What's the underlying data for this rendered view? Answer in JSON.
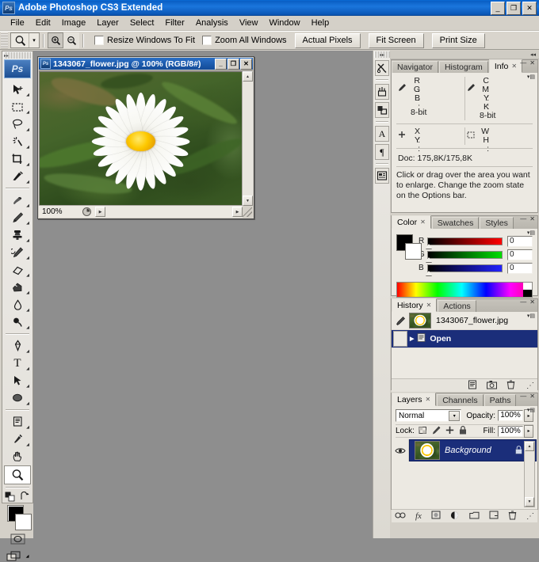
{
  "window": {
    "title": "Adobe Photoshop CS3 Extended",
    "app_icon": "Ps",
    "buttons": {
      "minimize": "_",
      "maximize": "❐",
      "close": "✕"
    }
  },
  "menubar": {
    "items": [
      "File",
      "Edit",
      "Image",
      "Layer",
      "Select",
      "Filter",
      "Analysis",
      "View",
      "Window",
      "Help"
    ]
  },
  "options_bar": {
    "active_tool_icon": "zoom-tool",
    "tool_preset_caret": "▾",
    "zoom_in_icon": "zoom-in-icon",
    "zoom_out_icon": "zoom-out-icon",
    "checkbox_resize_windows": {
      "label": "Resize Windows To Fit",
      "checked": false
    },
    "checkbox_zoom_all": {
      "label": "Zoom All Windows",
      "checked": false
    },
    "buttons": [
      "Actual Pixels",
      "Fit Screen",
      "Print Size"
    ]
  },
  "toolbox": {
    "badge": "Ps",
    "tools": [
      {
        "name": "move-tool",
        "glyph": "✥",
        "sub": true
      },
      {
        "name": "rectangular-marquee-tool",
        "glyph": "▭",
        "sub": true
      },
      {
        "name": "lasso-tool",
        "glyph": "◯",
        "sub": true
      },
      {
        "name": "magic-wand-tool",
        "glyph": "✧",
        "sub": true
      },
      {
        "name": "crop-tool",
        "glyph": "⌗",
        "sub": true
      },
      {
        "name": "slice-tool",
        "glyph": "🔪",
        "sub": true
      },
      {
        "name": "healing-brush-tool",
        "glyph": "✎",
        "sub": true
      },
      {
        "name": "brush-tool",
        "glyph": "🖌",
        "sub": true
      },
      {
        "name": "clone-stamp-tool",
        "glyph": "⎙",
        "sub": true
      },
      {
        "name": "history-brush-tool",
        "glyph": "❧",
        "sub": true
      },
      {
        "name": "eraser-tool",
        "glyph": "▱",
        "sub": true
      },
      {
        "name": "gradient-tool",
        "glyph": "◫",
        "sub": true
      },
      {
        "name": "blur-tool",
        "glyph": "💧",
        "sub": true
      },
      {
        "name": "dodge-tool",
        "glyph": "●",
        "sub": true
      },
      {
        "name": "pen-tool",
        "glyph": "✒",
        "sub": true
      },
      {
        "name": "type-tool",
        "glyph": "T",
        "sub": true
      },
      {
        "name": "path-selection-tool",
        "glyph": "➤",
        "sub": true
      },
      {
        "name": "ellipse-shape-tool",
        "glyph": "⬭",
        "sub": true
      },
      {
        "name": "notes-tool",
        "glyph": "🗒",
        "sub": true
      },
      {
        "name": "eyedropper-tool",
        "glyph": "⚲",
        "sub": true
      },
      {
        "name": "hand-tool",
        "glyph": "✋",
        "sub": false
      },
      {
        "name": "zoom-tool",
        "glyph": "⚲",
        "sub": false,
        "active": true
      }
    ],
    "swatch_default_icon": "default-colors-icon",
    "swatch_swap_icon": "swap-colors-icon",
    "foreground_color": "#000000",
    "background_color": "#ffffff",
    "quick_mask_icon": "quick-mask-icon",
    "screen_mode_icon": "screen-mode-icon"
  },
  "document": {
    "title": "1343067_flower.jpg @ 100% (RGB/8#)",
    "icon": "Ps",
    "buttons": {
      "minimize": "_",
      "maximize": "❐",
      "close": "✕"
    },
    "zoom_level": "100%",
    "status_info": "",
    "scroll_up": "▲",
    "scroll_down": "▼",
    "scroll_left": "◀",
    "scroll_right": "▶"
  },
  "dock_strip": {
    "buttons": [
      {
        "name": "tool-presets-icon",
        "glyph": "✂"
      },
      {
        "name": "brushes-icon",
        "glyph": "🖌"
      },
      {
        "name": "clone-source-icon",
        "glyph": "⧉"
      },
      {
        "name": "character-icon",
        "glyph": "A"
      },
      {
        "name": "paragraph-icon",
        "glyph": "¶"
      },
      {
        "name": "layer-comps-icon",
        "glyph": "▤"
      }
    ],
    "collapse_icon": "▸▸"
  },
  "panels": {
    "info": {
      "tabs": [
        {
          "label": "Navigator",
          "active": false,
          "closable": false
        },
        {
          "label": "Histogram",
          "active": false,
          "closable": false
        },
        {
          "label": "Info",
          "active": true,
          "closable": true
        }
      ],
      "menu_icon": "panel-menu-icon",
      "left_readout": {
        "marker": "eyedropper-icon",
        "rows": [
          "R :",
          "G :",
          "B :"
        ],
        "depth": "8-bit"
      },
      "right_readout": {
        "marker": "eyedropper-icon",
        "rows": [
          "C :",
          "M :",
          "Y :",
          "K :"
        ],
        "depth": "8-bit"
      },
      "coords": {
        "marker": "crosshair-icon",
        "rows": [
          "X :",
          "Y :"
        ]
      },
      "dimensions": {
        "marker": "selection-icon",
        "rows": [
          "W :",
          "H :"
        ]
      },
      "doc_size": "Doc: 175,8K/175,8K",
      "hint": "Click or drag over the area you want to enlarge. Change the zoom state on the Options bar."
    },
    "color": {
      "tabs": [
        {
          "label": "Color",
          "active": true,
          "closable": true
        },
        {
          "label": "Swatches",
          "active": false,
          "closable": false
        },
        {
          "label": "Styles",
          "active": false,
          "closable": false
        }
      ],
      "foreground_color": "#000000",
      "background_color": "#ffffff",
      "sliders": [
        {
          "label": "R",
          "value": "0",
          "from": "#000000",
          "to": "#ff0000"
        },
        {
          "label": "G",
          "value": "0",
          "from": "#000000",
          "to": "#00dd00"
        },
        {
          "label": "B",
          "value": "0",
          "from": "#000000",
          "to": "#2222ff"
        }
      ]
    },
    "history": {
      "tabs": [
        {
          "label": "History",
          "active": true,
          "closable": true
        },
        {
          "label": "Actions",
          "active": false,
          "closable": false
        }
      ],
      "snapshot": {
        "name": "1343067_flower.jpg",
        "icon": "history-brush-source-icon"
      },
      "states": [
        {
          "name": "Open",
          "icon": "open-state-icon",
          "selected": true
        }
      ],
      "footer_icons": [
        {
          "name": "new-document-from-state-icon",
          "glyph": "▤"
        },
        {
          "name": "new-snapshot-icon",
          "glyph": "📷"
        },
        {
          "name": "delete-state-icon",
          "glyph": "🗑"
        }
      ]
    },
    "layers": {
      "tabs": [
        {
          "label": "Layers",
          "active": true,
          "closable": true
        },
        {
          "label": "Channels",
          "active": false,
          "closable": false
        },
        {
          "label": "Paths",
          "active": false,
          "closable": false
        }
      ],
      "blend_mode": "Normal",
      "opacity_label": "Opacity:",
      "opacity_value": "100%",
      "lock_label": "Lock:",
      "lock_icons": [
        {
          "name": "lock-transparent-pixels-icon",
          "glyph": "▨"
        },
        {
          "name": "lock-image-pixels-icon",
          "glyph": "🖌"
        },
        {
          "name": "lock-position-icon",
          "glyph": "✥"
        },
        {
          "name": "lock-all-icon",
          "glyph": "🔒"
        }
      ],
      "fill_label": "Fill:",
      "fill_value": "100%",
      "rows": [
        {
          "name": "Background",
          "visible": true,
          "selected": true,
          "locked": true,
          "eye_icon": "eye-icon",
          "lock_icon": "lock-icon"
        }
      ],
      "footer_icons": [
        {
          "name": "link-layers-icon",
          "glyph": "👓"
        },
        {
          "name": "add-layer-style-icon",
          "glyph": "fx"
        },
        {
          "name": "add-layer-mask-icon",
          "glyph": "▢"
        },
        {
          "name": "new-fill-adjustment-layer-icon",
          "glyph": "◑"
        },
        {
          "name": "new-group-icon",
          "glyph": "▭"
        },
        {
          "name": "new-layer-icon",
          "glyph": "❐"
        },
        {
          "name": "delete-layer-icon",
          "glyph": "🗑"
        }
      ]
    }
  },
  "colors": {
    "titlebar_blue": "#0a5fc4",
    "chrome_gray": "#d4d0c8",
    "panel_bg": "#ece9e2",
    "selection_blue": "#1b2e7a"
  }
}
